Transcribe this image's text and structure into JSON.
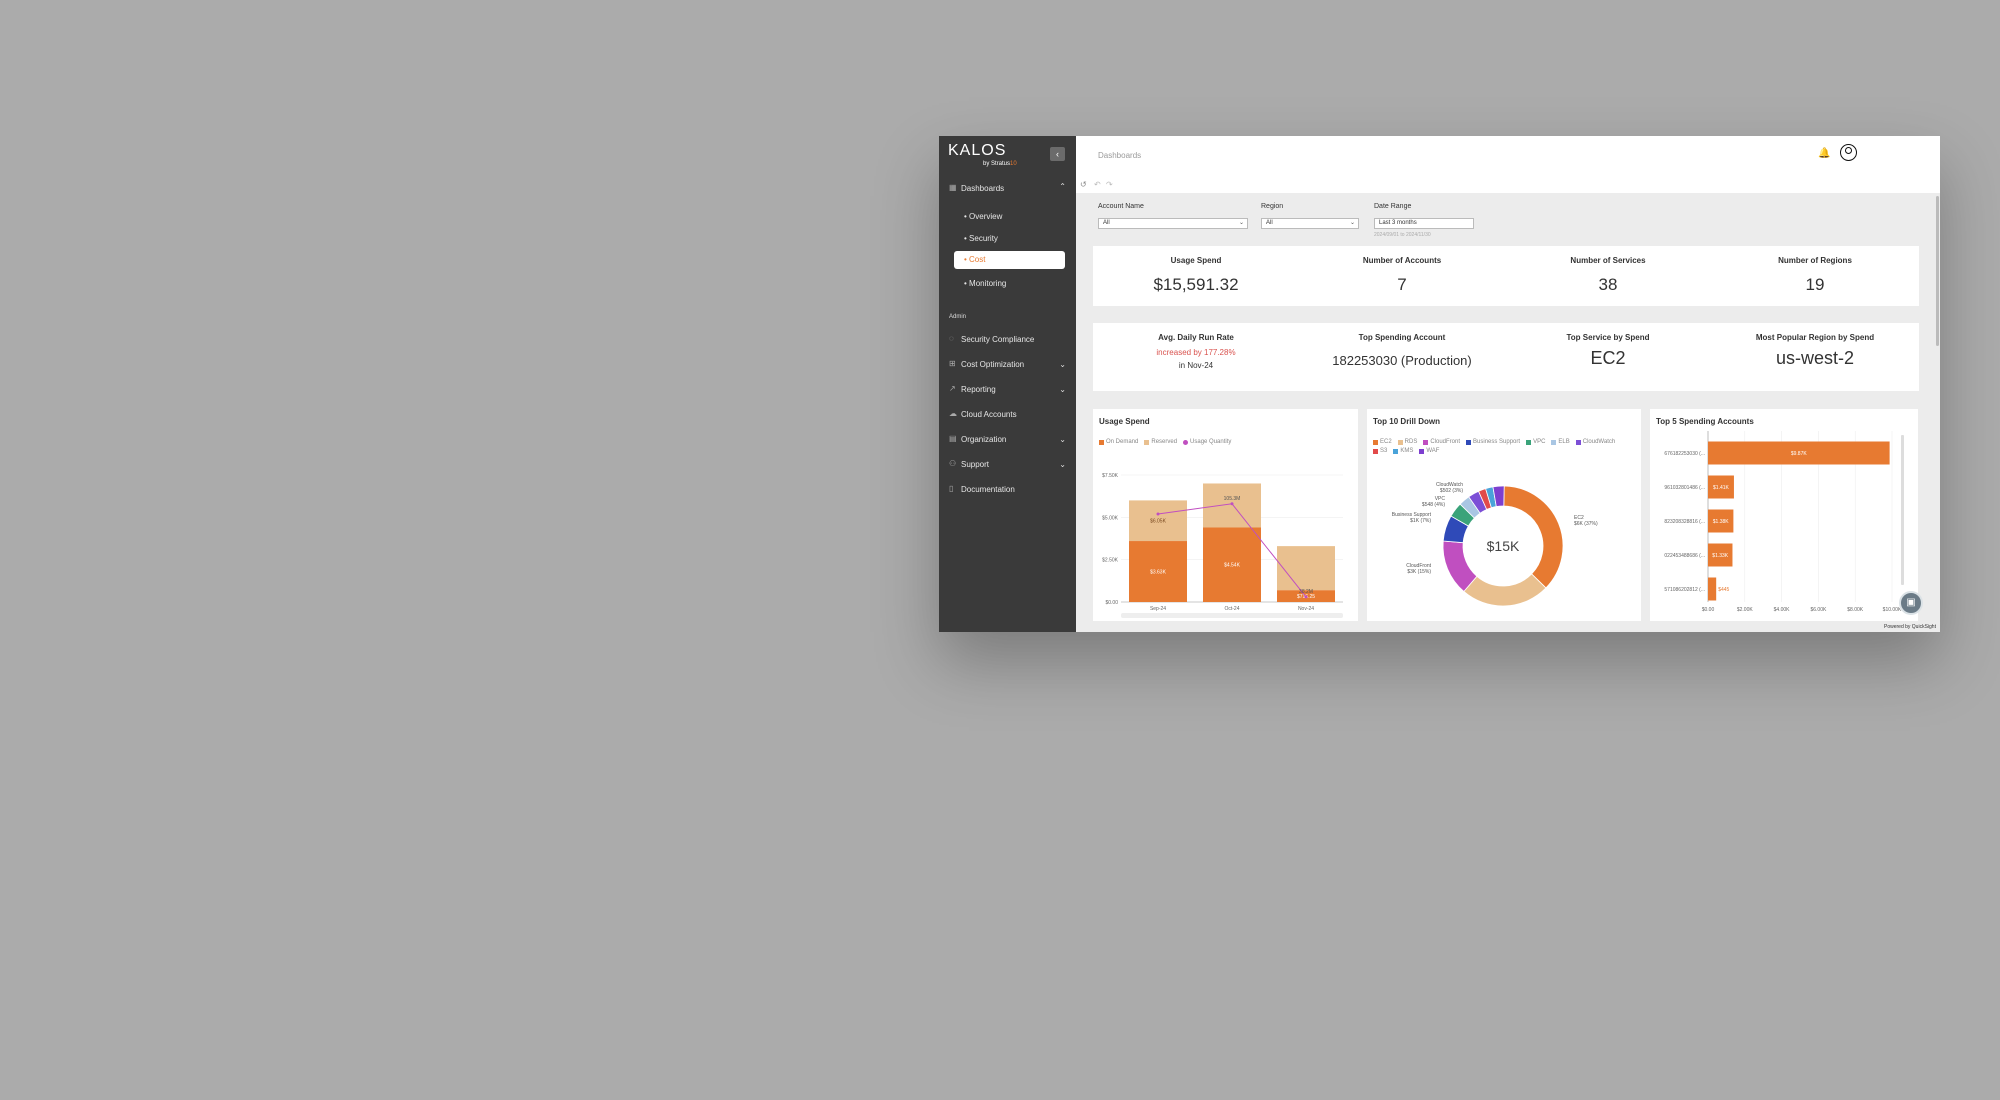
{
  "sidebar": {
    "logo": {
      "brand": "KALOS",
      "by": "by Stratus",
      "by_accent": "10"
    },
    "collapse_icon": "chevron-left-icon",
    "dashboards_label": "Dashboards",
    "sub_items": [
      "Overview",
      "Security",
      "Cost",
      "Monitoring"
    ],
    "active_sub": "Cost",
    "admin_label": "Admin",
    "admin_items": [
      {
        "label": "Security Compliance",
        "icon": "shield-icon",
        "expandable": false
      },
      {
        "label": "Cost Optimization",
        "icon": "tag-icon",
        "expandable": true
      },
      {
        "label": "Reporting",
        "icon": "chart-icon",
        "expandable": true
      },
      {
        "label": "Cloud Accounts",
        "icon": "cloud-icon",
        "expandable": false
      },
      {
        "label": "Organization",
        "icon": "grid-icon",
        "expandable": true
      },
      {
        "label": "Support",
        "icon": "people-icon",
        "expandable": true
      },
      {
        "label": "Documentation",
        "icon": "doc-icon",
        "expandable": false
      }
    ]
  },
  "header": {
    "breadcrumb": "Dashboards"
  },
  "filters": {
    "account": {
      "label": "Account Name",
      "value": "All"
    },
    "region": {
      "label": "Region",
      "value": "All"
    },
    "date": {
      "label": "Date Range",
      "value": "Last 3 months",
      "hint": "2024/09/01 to 2024/11/30"
    }
  },
  "kpi_row1": [
    {
      "title": "Usage Spend",
      "value": "$15,591.32"
    },
    {
      "title": "Number of Accounts",
      "value": "7"
    },
    {
      "title": "Number of Services",
      "value": "38"
    },
    {
      "title": "Number of Regions",
      "value": "19"
    }
  ],
  "kpi_row2": {
    "run_rate": {
      "title": "Avg. Daily Run Rate",
      "change": "increased by 177.28%",
      "period": "in Nov-24",
      "change_color": "#d9534f"
    },
    "top_account": {
      "title": "Top Spending Account",
      "value": "182253030 (Production)"
    },
    "top_service": {
      "title": "Top Service by Spend",
      "value": "EC2"
    },
    "top_region": {
      "title": "Most Popular Region by Spend",
      "value": "us-west-2"
    }
  },
  "usage_panel": {
    "title": "Usage Spend",
    "legend": [
      "On Demand",
      "Reserved",
      "Usage Quantity"
    ],
    "colors": {
      "on_demand": "#e77a31",
      "reserved": "#e9c08f",
      "usage": "#c04fc0"
    }
  },
  "drill_panel": {
    "title": "Top 10 Drill Down",
    "legend": [
      {
        "name": "EC2",
        "color": "#e77a31"
      },
      {
        "name": "RDS",
        "color": "#e9c08f"
      },
      {
        "name": "CloudFront",
        "color": "#c04fc0"
      },
      {
        "name": "Business Support",
        "color": "#2f4ab8"
      },
      {
        "name": "VPC",
        "color": "#3aa37a"
      },
      {
        "name": "ELB",
        "color": "#a9c6e3"
      },
      {
        "name": "CloudWatch",
        "color": "#7c4fd6"
      },
      {
        "name": "S3",
        "color": "#e24a4a"
      },
      {
        "name": "KMS",
        "color": "#4aa3d9"
      },
      {
        "name": "WAF",
        "color": "#7d3fcf"
      }
    ],
    "center_label": "$15K",
    "callouts": {
      "ec2": [
        "EC2",
        "$6K (37%)"
      ],
      "cloudfront": [
        "CloudFront",
        "$3K (15%)"
      ],
      "business": [
        "Business Support",
        "$1K (7%)"
      ],
      "vpc": [
        "VPC",
        "$548 (4%)"
      ],
      "cloudwatch": [
        "CloudWatch",
        "$502 (3%)"
      ]
    }
  },
  "accounts_panel": {
    "title": "Top 5 Spending Accounts"
  },
  "chart_data": [
    {
      "type": "bar",
      "title": "Usage Spend",
      "categories": [
        "Sep-24",
        "Oct-24",
        "Nov-24"
      ],
      "series": [
        {
          "name": "On Demand",
          "values": [
            3600,
            4400,
            700
          ],
          "labels": [
            "$3.63K",
            "$4.54K",
            "$716.25"
          ]
        },
        {
          "name": "Reserved",
          "values": [
            2400,
            2600,
            2600
          ],
          "labels": [
            "$6.05K",
            "",
            ""
          ]
        },
        {
          "name": "Usage Quantity",
          "type": "line",
          "values": [
            5200,
            5800,
            300
          ],
          "labels": [
            "",
            "105.3M",
            "38.2M"
          ]
        }
      ],
      "ylim": [
        0,
        7500
      ],
      "yticks": [
        "$0.00",
        "$2.50K",
        "$5.00K",
        "$7.50K"
      ]
    },
    {
      "type": "pie",
      "title": "Top 10 Drill Down",
      "labels": [
        "EC2",
        "RDS",
        "CloudFront",
        "Business Support",
        "VPC",
        "ELB",
        "CloudWatch",
        "S3",
        "KMS",
        "WAF"
      ],
      "values": [
        37,
        24,
        15,
        7,
        4,
        3,
        3,
        2,
        2,
        3
      ]
    },
    {
      "type": "bar",
      "orientation": "horizontal",
      "title": "Top 5 Spending Accounts",
      "categories": [
        "676182253030 (...",
        "961032801486 (...",
        "823208328816 (...",
        "022453488686 (...",
        "571086202812 (..."
      ],
      "values": [
        9870,
        1410,
        1380,
        1330,
        445
      ],
      "labels": [
        "$9.87K",
        "$1.41K",
        "$1.38K",
        "$1.33K",
        "$445"
      ],
      "xticks": [
        "$0.00",
        "$2.00K",
        "$4.00K",
        "$6.00K",
        "$8.00K",
        "$10.00K"
      ],
      "xlim": [
        0,
        10000
      ]
    }
  ],
  "footer": {
    "powered": "Powered by QuickSight"
  }
}
